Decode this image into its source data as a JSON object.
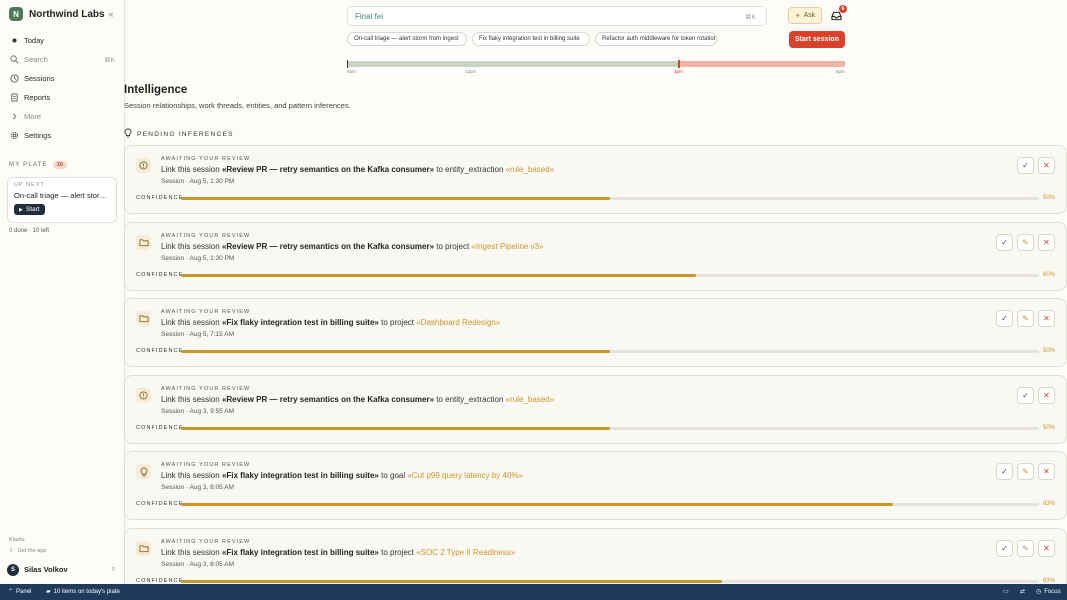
{
  "brand": {
    "logo_letter": "N",
    "name": "Northwind Labs",
    "collapse_icon": "collapse-sidebar-icon"
  },
  "nav": [
    {
      "label": "Today",
      "icon": "dot-icon"
    },
    {
      "label": "Search",
      "icon": "search-icon",
      "kbd": "⌘K"
    },
    {
      "label": "Sessions",
      "icon": "clock-icon"
    },
    {
      "label": "Reports",
      "icon": "document-icon"
    },
    {
      "label": "More",
      "icon": "chevron-right-icon"
    },
    {
      "label": "Settings",
      "icon": "gear-icon"
    }
  ],
  "plate": {
    "label": "MY PLATE",
    "count": "10",
    "up_next_label": "UP NEXT",
    "up_next_title": "On-call triage — alert storm from ingest",
    "start_label": "Start",
    "progress": "0 done · 10 left"
  },
  "footer": {
    "klaetu": "Klaetu",
    "get_app": "Get the app"
  },
  "user": {
    "initial": "S",
    "name": "Silas Volkov"
  },
  "search": {
    "value": "Final fei",
    "kbd": "⌘K"
  },
  "topbar": {
    "ask_label": "Ask",
    "inbox_badge": "6",
    "start_session_label": "Start session"
  },
  "chips": [
    "On-call triage — alert storm from ingest",
    "Fix flaky integration test in billing suite",
    "Refactor auth middleware for token rotation"
  ],
  "timeline": {
    "ticks": [
      "9am",
      "12pm",
      "3pm",
      "6pm"
    ],
    "colors": {
      "past": "#c7d4c4",
      "future": "#efb5a3",
      "now": "#d9412a"
    }
  },
  "page": {
    "title": "Intelligence",
    "subtitle": "Session relationships, work threads, entities, and pattern inferences.",
    "section_label": "PENDING INFERENCES"
  },
  "cards": [
    {
      "icon": "alert-circle-icon",
      "eyebrow": "AWAITING YOUR REVIEW",
      "prefix": "Link this session",
      "subject": "«Review PR — retry semantics on the Kafka consumer»",
      "connector": "to entity_extraction",
      "target": "«rule_based»",
      "meta": "Session · Aug 5, 1:30 PM",
      "confidence_label": "CONFIDENCE",
      "confidence": 0.5,
      "pct": "50%",
      "editable": false
    },
    {
      "icon": "folder-icon",
      "eyebrow": "AWAITING YOUR REVIEW",
      "prefix": "Link this session",
      "subject": "«Review PR — retry semantics on the Kafka consumer»",
      "connector": "to project",
      "target": "«Ingest Pipeline v3»",
      "meta": "Session · Aug 5, 1:30 PM",
      "confidence_label": "CONFIDENCE",
      "confidence": 0.6,
      "pct": "60%",
      "editable": true
    },
    {
      "icon": "folder-icon",
      "eyebrow": "AWAITING YOUR REVIEW",
      "prefix": "Link this session",
      "subject": "«Fix flaky integration test in billing suite»",
      "connector": "to project",
      "target": "«Dashboard Redesign»",
      "meta": "Session · Aug 5, 7:15 AM",
      "confidence_label": "CONFIDENCE",
      "confidence": 0.5,
      "pct": "50%",
      "editable": true
    },
    {
      "icon": "alert-circle-icon",
      "eyebrow": "AWAITING YOUR REVIEW",
      "prefix": "Link this session",
      "subject": "«Review PR — retry semantics on the Kafka consumer»",
      "connector": "to entity_extraction",
      "target": "«rule_based»",
      "meta": "Session · Aug 3, 9:55 AM",
      "confidence_label": "CONFIDENCE",
      "confidence": 0.5,
      "pct": "50%",
      "editable": false
    },
    {
      "icon": "lightbulb-icon",
      "eyebrow": "AWAITING YOUR REVIEW",
      "prefix": "Link this session",
      "subject": "«Fix flaky integration test in billing suite»",
      "connector": "to goal",
      "target": "«Cut p99 query latency by 40%»",
      "meta": "Session · Aug 3, 8:05 AM",
      "confidence_label": "CONFIDENCE",
      "confidence": 0.83,
      "pct": "83%",
      "editable": true
    },
    {
      "icon": "folder-icon",
      "eyebrow": "AWAITING YOUR REVIEW",
      "prefix": "Link this session",
      "subject": "«Fix flaky integration test in billing suite»",
      "connector": "to project",
      "target": "«SOC 2 Type II Readiness»",
      "meta": "Session · Aug 3, 8:05 AM",
      "confidence_label": "CONFIDENCE",
      "confidence": 0.63,
      "pct": "63%",
      "editable": true
    }
  ],
  "statusbar": {
    "panel": "Panel",
    "plate": "10 items on today's plate",
    "focus": "Focus"
  },
  "colors": {
    "accent": "#d9412a",
    "gold": "#c8962a",
    "status_bar": "#1f3a5a",
    "brand": "#4d7a5c"
  }
}
